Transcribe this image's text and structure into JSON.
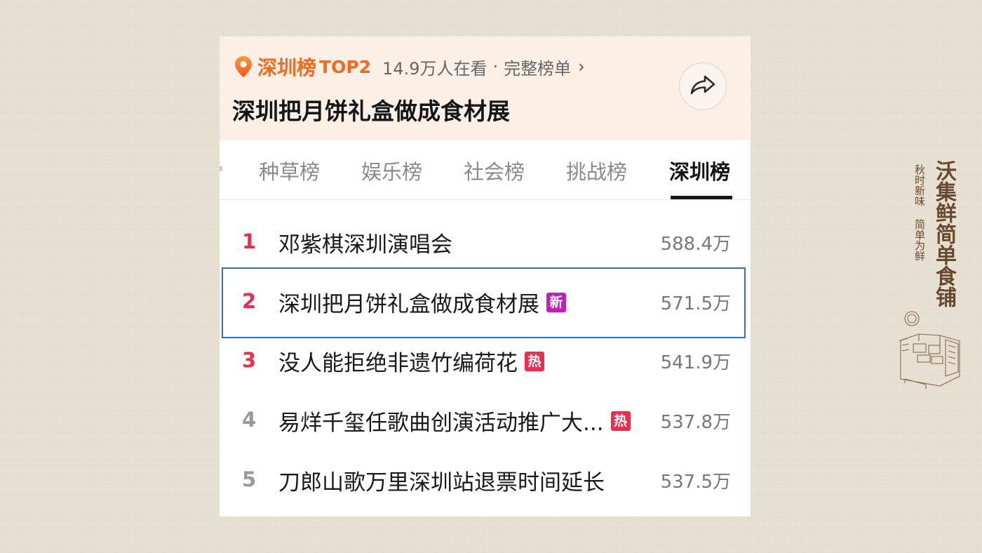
{
  "header": {
    "rank_name": "深圳榜",
    "rank_position": "TOP2",
    "viewers": "14.9万人在看",
    "separator": "·",
    "full_list_label": "完整榜单",
    "chevron": "›",
    "topic_title": "深圳把月饼礼盒做成食材展",
    "pin_icon": "location-pin-icon",
    "share_icon": "share-arrow-icon",
    "accent_color": "#f26b1d"
  },
  "tabs": [
    {
      "label": "种草榜",
      "active": false
    },
    {
      "label": "娱乐榜",
      "active": false
    },
    {
      "label": "社会榜",
      "active": false
    },
    {
      "label": "挑战榜",
      "active": false
    },
    {
      "label": "深圳榜",
      "active": true
    }
  ],
  "list": [
    {
      "rank": "1",
      "title": "邓紫棋深圳演唱会",
      "badge": "",
      "count": "588.4万",
      "rank_color": "#ee2d4d"
    },
    {
      "rank": "2",
      "title": "深圳把月饼礼盒做成食材展",
      "badge": "新",
      "count": "571.5万",
      "rank_color": "#ee2d4d"
    },
    {
      "rank": "3",
      "title": "没人能拒绝非遗竹编荷花",
      "badge": "热",
      "count": "541.9万",
      "rank_color": "#ee2d4d"
    },
    {
      "rank": "4",
      "title": "易烊千玺任歌曲创演活动推广大...",
      "badge": "热",
      "count": "537.8万",
      "rank_color": "#9a9a9a"
    },
    {
      "rank": "5",
      "title": "刀郎山歌万里深圳站退票时间延长",
      "badge": "",
      "count": "537.5万",
      "rank_color": "#9a9a9a"
    }
  ],
  "brand": {
    "name": "沃集鲜简单食铺",
    "slogan": "秋时新味 简单为鲜",
    "brand_color": "#6a4a2e"
  }
}
